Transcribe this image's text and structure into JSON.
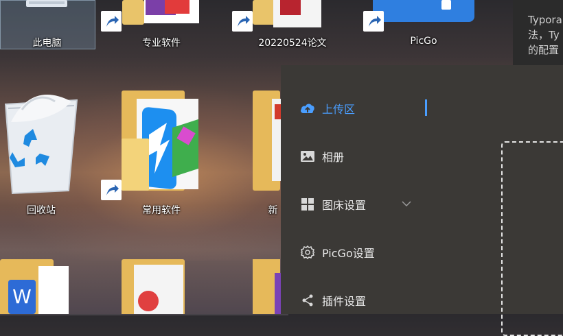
{
  "desktop": {
    "icons": [
      {
        "label": "此电脑"
      },
      {
        "label": "专业软件"
      },
      {
        "label": "20220524论文"
      },
      {
        "label": "PicGo"
      },
      {
        "label": "回收站"
      },
      {
        "label": "常用软件"
      },
      {
        "label": "新建"
      }
    ]
  },
  "tooltip": {
    "lines": [
      "Typora",
      "法，Ty",
      "的配置"
    ]
  },
  "picgo": {
    "menu": [
      {
        "label": "上传区",
        "icon": "cloud-upload-icon",
        "active": true
      },
      {
        "label": "相册",
        "icon": "image-icon"
      },
      {
        "label": "图床设置",
        "icon": "grid-icon"
      },
      {
        "label": "PicGo设置",
        "icon": "gear-icon"
      },
      {
        "label": "插件设置",
        "icon": "share-icon"
      }
    ],
    "accent_color": "#4a9eff"
  }
}
